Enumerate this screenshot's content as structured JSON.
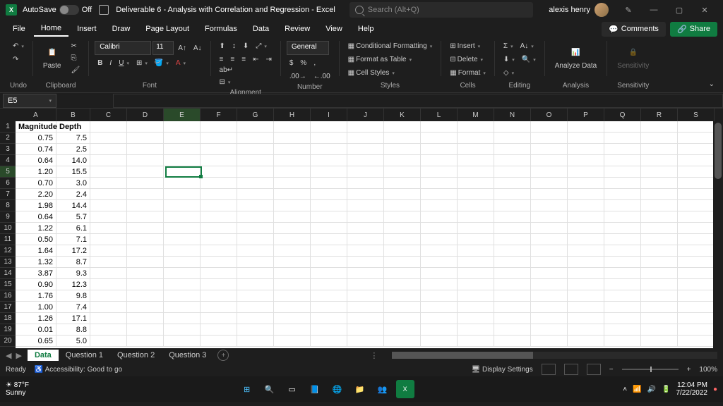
{
  "titlebar": {
    "autosave_label": "AutoSave",
    "autosave_state": "Off",
    "title": "Deliverable 6 - Analysis with Correlation and Regression - Excel",
    "search_placeholder": "Search (Alt+Q)",
    "user_name": "alexis henry"
  },
  "tabs": {
    "items": [
      "File",
      "Home",
      "Insert",
      "Draw",
      "Page Layout",
      "Formulas",
      "Data",
      "Review",
      "View",
      "Help"
    ],
    "active": "Home",
    "comments": "Comments",
    "share": "Share"
  },
  "ribbon": {
    "groups": {
      "undo": "Undo",
      "clipboard": "Clipboard",
      "font": "Font",
      "alignment": "Alignment",
      "number": "Number",
      "styles": "Styles",
      "cells": "Cells",
      "editing": "Editing",
      "analysis": "Analysis",
      "sensitivity": "Sensitivity"
    },
    "paste": "Paste",
    "font_name": "Calibri",
    "font_size": "11",
    "number_format": "General",
    "currency": "$",
    "percent": "%",
    "comma": ",",
    "cond_format": "Conditional Formatting",
    "format_table": "Format as Table",
    "cell_styles": "Cell Styles",
    "insert": "Insert",
    "delete": "Delete",
    "format": "Format",
    "analyze": "Analyze Data",
    "sensitivity_btn": "Sensitivity"
  },
  "formula": {
    "name_box": "E5",
    "content": ""
  },
  "grid": {
    "columns": [
      "A",
      "B",
      "C",
      "D",
      "E",
      "F",
      "G",
      "H",
      "I",
      "J",
      "K",
      "L",
      "M",
      "N",
      "O",
      "P",
      "Q",
      "R",
      "S"
    ],
    "headers": {
      "a": "Magnitude",
      "b": "Depth"
    },
    "rows": [
      {
        "n": 1,
        "a": "Magnitude",
        "b": "Depth",
        "header": true
      },
      {
        "n": 2,
        "a": "0.75",
        "b": "7.5"
      },
      {
        "n": 3,
        "a": "0.74",
        "b": "2.5"
      },
      {
        "n": 4,
        "a": "0.64",
        "b": "14.0"
      },
      {
        "n": 5,
        "a": "1.20",
        "b": "15.5"
      },
      {
        "n": 6,
        "a": "0.70",
        "b": "3.0"
      },
      {
        "n": 7,
        "a": "2.20",
        "b": "2.4"
      },
      {
        "n": 8,
        "a": "1.98",
        "b": "14.4"
      },
      {
        "n": 9,
        "a": "0.64",
        "b": "5.7"
      },
      {
        "n": 10,
        "a": "1.22",
        "b": "6.1"
      },
      {
        "n": 11,
        "a": "0.50",
        "b": "7.1"
      },
      {
        "n": 12,
        "a": "1.64",
        "b": "17.2"
      },
      {
        "n": 13,
        "a": "1.32",
        "b": "8.7"
      },
      {
        "n": 14,
        "a": "3.87",
        "b": "9.3"
      },
      {
        "n": 15,
        "a": "0.90",
        "b": "12.3"
      },
      {
        "n": 16,
        "a": "1.76",
        "b": "9.8"
      },
      {
        "n": 17,
        "a": "1.00",
        "b": "7.4"
      },
      {
        "n": 18,
        "a": "1.26",
        "b": "17.1"
      },
      {
        "n": 19,
        "a": "0.01",
        "b": "8.8"
      },
      {
        "n": 20,
        "a": "0.65",
        "b": "5.0"
      }
    ],
    "selected_cell": "E5"
  },
  "sheets": {
    "tabs": [
      "Data",
      "Question 1",
      "Question 2",
      "Question 3"
    ],
    "active": "Data"
  },
  "statusbar": {
    "ready": "Ready",
    "accessibility": "Accessibility: Good to go",
    "display": "Display Settings",
    "zoom": "100%"
  },
  "taskbar": {
    "temp": "87°F",
    "weather": "Sunny",
    "time": "12:04 PM",
    "date": "7/22/2022"
  }
}
